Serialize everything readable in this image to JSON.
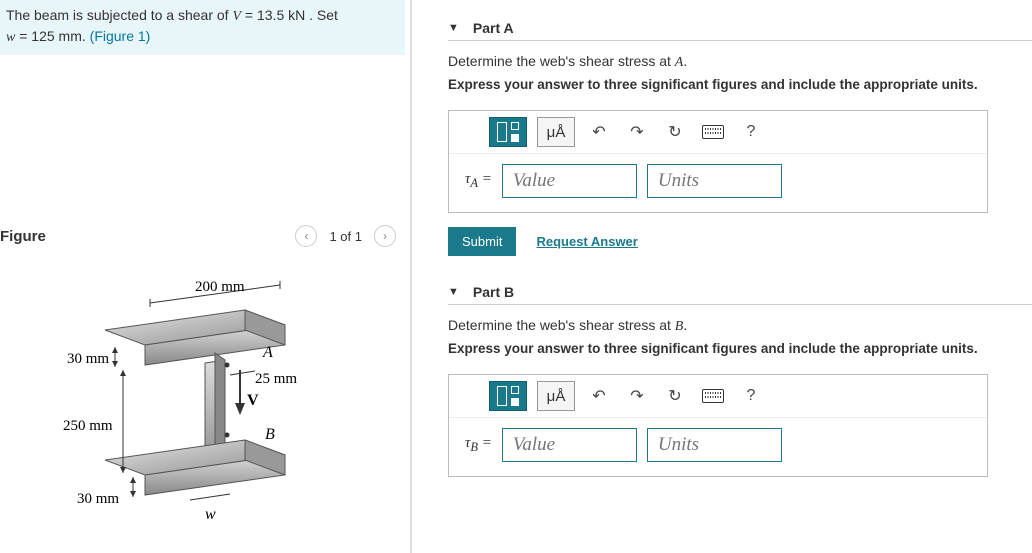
{
  "problem": {
    "text_before_V": "The beam is subjected to a shear of ",
    "V_symbol": "V",
    "V_equals": " = 13.5 ",
    "V_unit": "kN",
    "text_after_V": " . Set ",
    "w_symbol": "w",
    "w_equals": " = 125 ",
    "w_unit": "mm",
    "text_end": ". ",
    "fig_ref": "(Figure 1)"
  },
  "figure": {
    "title": "Figure",
    "pager": "1 of 1",
    "labels": {
      "top_width": "200 mm",
      "flange_thk": "30 mm",
      "web_thk": "25 mm",
      "web_height": "250 mm",
      "bottom_thk": "30 mm",
      "point_A": "A",
      "point_B": "B",
      "shear": "V",
      "width_var": "w"
    }
  },
  "partA": {
    "title": "Part A",
    "question_before": "Determine the web's shear stress at ",
    "point": "A",
    "question_after": ".",
    "instruction": "Express your answer to three significant figures and include the appropriate units.",
    "toolbar": {
      "ua_label": "μÅ",
      "help": "?"
    },
    "var_label": "τ",
    "var_sub": "A",
    "equals": " = ",
    "value_ph": "Value",
    "units_ph": "Units",
    "submit": "Submit",
    "request": "Request Answer"
  },
  "partB": {
    "title": "Part B",
    "question_before": "Determine the web's shear stress at ",
    "point": "B",
    "question_after": ".",
    "instruction": "Express your answer to three significant figures and include the appropriate units.",
    "toolbar": {
      "ua_label": "μÅ",
      "help": "?"
    },
    "var_label": "τ",
    "var_sub": "B",
    "equals": " = ",
    "value_ph": "Value",
    "units_ph": "Units"
  }
}
